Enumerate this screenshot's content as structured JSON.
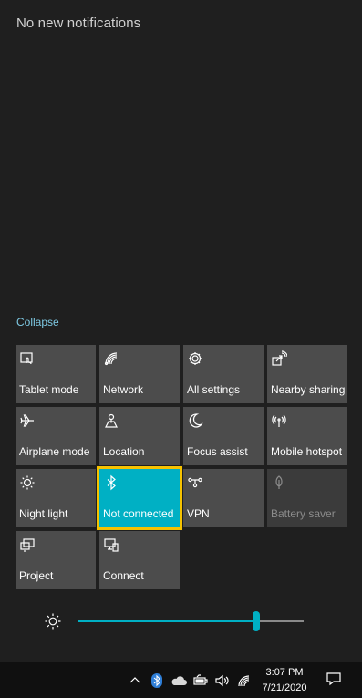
{
  "notifications": {
    "empty_text": "No new notifications"
  },
  "quick_actions": {
    "collapse_label": "Collapse",
    "tiles": [
      {
        "label": "Tablet mode",
        "icon": "tablet-mode-icon",
        "state": "off"
      },
      {
        "label": "Network",
        "icon": "network-icon",
        "state": "off"
      },
      {
        "label": "All settings",
        "icon": "gear-icon",
        "state": "off"
      },
      {
        "label": "Nearby sharing",
        "icon": "nearby-sharing-icon",
        "state": "off"
      },
      {
        "label": "Airplane mode",
        "icon": "airplane-icon",
        "state": "off"
      },
      {
        "label": "Location",
        "icon": "location-icon",
        "state": "off"
      },
      {
        "label": "Focus assist",
        "icon": "moon-icon",
        "state": "off"
      },
      {
        "label": "Mobile hotspot",
        "icon": "hotspot-icon",
        "state": "off"
      },
      {
        "label": "Night light",
        "icon": "night-light-icon",
        "state": "off"
      },
      {
        "label": "Not connected",
        "icon": "bluetooth-icon",
        "state": "on"
      },
      {
        "label": "VPN",
        "icon": "vpn-icon",
        "state": "off"
      },
      {
        "label": "Battery saver",
        "icon": "leaf-icon",
        "state": "disabled"
      },
      {
        "label": "Project",
        "icon": "project-icon",
        "state": "off"
      },
      {
        "label": "Connect",
        "icon": "connect-icon",
        "state": "off"
      }
    ]
  },
  "brightness": {
    "level": 0.79,
    "icon": "sun-icon"
  },
  "taskbar": {
    "time": "3:07 PM",
    "date": "7/21/2020",
    "tray_icons": [
      "chevron-up-icon",
      "bluetooth-icon",
      "onedrive-cloud-icon",
      "battery-icon",
      "volume-icon",
      "wifi-icon"
    ],
    "notification_icon": "action-center-icon"
  },
  "colors": {
    "accent": "#00b0c4",
    "focus_outline": "#f6c200",
    "tile": "#4c4c4c",
    "background": "#1f1f1f",
    "link": "#7ec9e3"
  }
}
